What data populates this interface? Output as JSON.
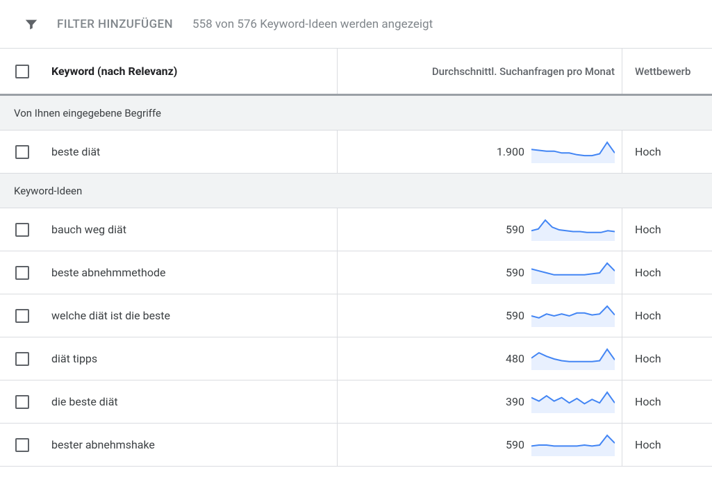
{
  "toolbar": {
    "add_filter": "FILTER HINZUFÜGEN",
    "results_text": "558 von 576 Keyword-Ideen werden angezeigt"
  },
  "columns": {
    "keyword": "Keyword (nach Relevanz)",
    "searches": "Durchschnittl. Suchanfragen pro Monat",
    "competition": "Wettbewerb"
  },
  "sections": {
    "provided": "Von Ihnen eingegebene Begriffe",
    "ideas": "Keyword-Ideen"
  },
  "provided_rows": [
    {
      "keyword": "beste diät",
      "searches": "1.900",
      "competition": "Hoch",
      "spark": [
        14,
        13,
        12,
        12,
        10,
        10,
        8,
        7,
        7,
        9,
        22,
        10
      ]
    }
  ],
  "idea_rows": [
    {
      "keyword": "bauch weg diät",
      "searches": "590",
      "competition": "Hoch",
      "spark": [
        10,
        12,
        22,
        14,
        11,
        10,
        9,
        9,
        8,
        8,
        8,
        10,
        9
      ]
    },
    {
      "keyword": "beste abnehmmethode",
      "searches": "590",
      "competition": "Hoch",
      "spark": [
        14,
        12,
        10,
        8,
        8,
        8,
        8,
        8,
        9,
        10,
        20,
        12
      ]
    },
    {
      "keyword": "welche diät ist die beste",
      "searches": "590",
      "competition": "Hoch",
      "spark": [
        10,
        8,
        12,
        10,
        12,
        10,
        13,
        13,
        11,
        12,
        20,
        11
      ]
    },
    {
      "keyword": "diät tipps",
      "searches": "480",
      "competition": "Hoch",
      "spark": [
        12,
        18,
        14,
        11,
        9,
        8,
        8,
        8,
        8,
        9,
        22,
        10
      ]
    },
    {
      "keyword": "die beste diät",
      "searches": "390",
      "competition": "Hoch",
      "spark": [
        16,
        12,
        18,
        12,
        16,
        10,
        15,
        9,
        14,
        10,
        22,
        10
      ]
    },
    {
      "keyword": "bester abnehmshake",
      "searches": "590",
      "competition": "Hoch",
      "spark": [
        9,
        10,
        10,
        9,
        9,
        9,
        9,
        10,
        9,
        10,
        20,
        12
      ]
    }
  ]
}
